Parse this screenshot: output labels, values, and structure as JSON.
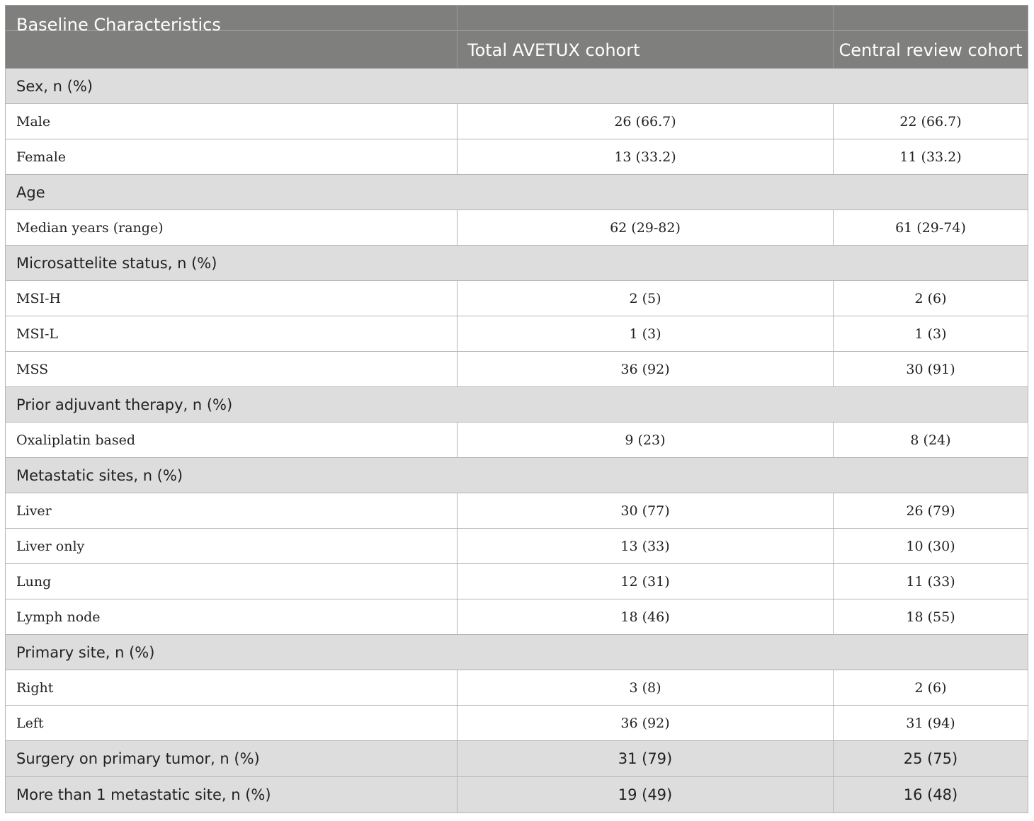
{
  "header": {
    "col1": "Baseline Characteristics",
    "col2": "Total AVETUX cohort",
    "col3": "Central review cohort"
  },
  "sections": {
    "sex": "Sex, n (%)",
    "age": "Age",
    "msi": "Microsattelite status, n (%)",
    "adjuvant": "Prior adjuvant therapy, n (%)",
    "metastatic": "Metastatic sites, n (%)",
    "primary": "Primary site, n (%)"
  },
  "rows": {
    "male": {
      "label": "Male",
      "total": "26 (66.7)",
      "central": "22 (66.7)"
    },
    "female": {
      "label": "Female",
      "total": "13 (33.2)",
      "central": "11 (33.2)"
    },
    "median": {
      "label": "Median years (range)",
      "total": "62 (29-82)",
      "central": "61 (29-74)"
    },
    "msih": {
      "label": "MSI-H",
      "total": "2 (5)",
      "central": "2 (6)"
    },
    "msil": {
      "label": "MSI-L",
      "total": "1 (3)",
      "central": "1 (3)"
    },
    "mss": {
      "label": "MSS",
      "total": "36 (92)",
      "central": "30 (91)"
    },
    "oxali": {
      "label": "Oxaliplatin based",
      "total": "9 (23)",
      "central": "8 (24)"
    },
    "liver": {
      "label": "Liver",
      "total": "30 (77)",
      "central": "26 (79)"
    },
    "liver_only": {
      "label": "Liver only",
      "total": "13 (33)",
      "central": "10 (30)"
    },
    "lung": {
      "label": "Lung",
      "total": "12 (31)",
      "central": "11 (33)"
    },
    "lymph": {
      "label": "Lymph node",
      "total": "18 (46)",
      "central": "18 (55)"
    },
    "right": {
      "label": "Right",
      "total": "3 (8)",
      "central": "2 (6)"
    },
    "left": {
      "label": "Left",
      "total": "36 (92)",
      "central": "31 (94)"
    },
    "surgery": {
      "label": "Surgery on primary tumor, n (%)",
      "total": "31 (79)",
      "central": "25 (75)"
    },
    "multi_met": {
      "label": "More than 1 metastatic site, n (%)",
      "total": "19 (49)",
      "central": "16 (48)"
    }
  },
  "colors": {
    "header_bg": "#7f7f7e",
    "section_bg": "#dddddd",
    "border": "#b5b5b5"
  }
}
